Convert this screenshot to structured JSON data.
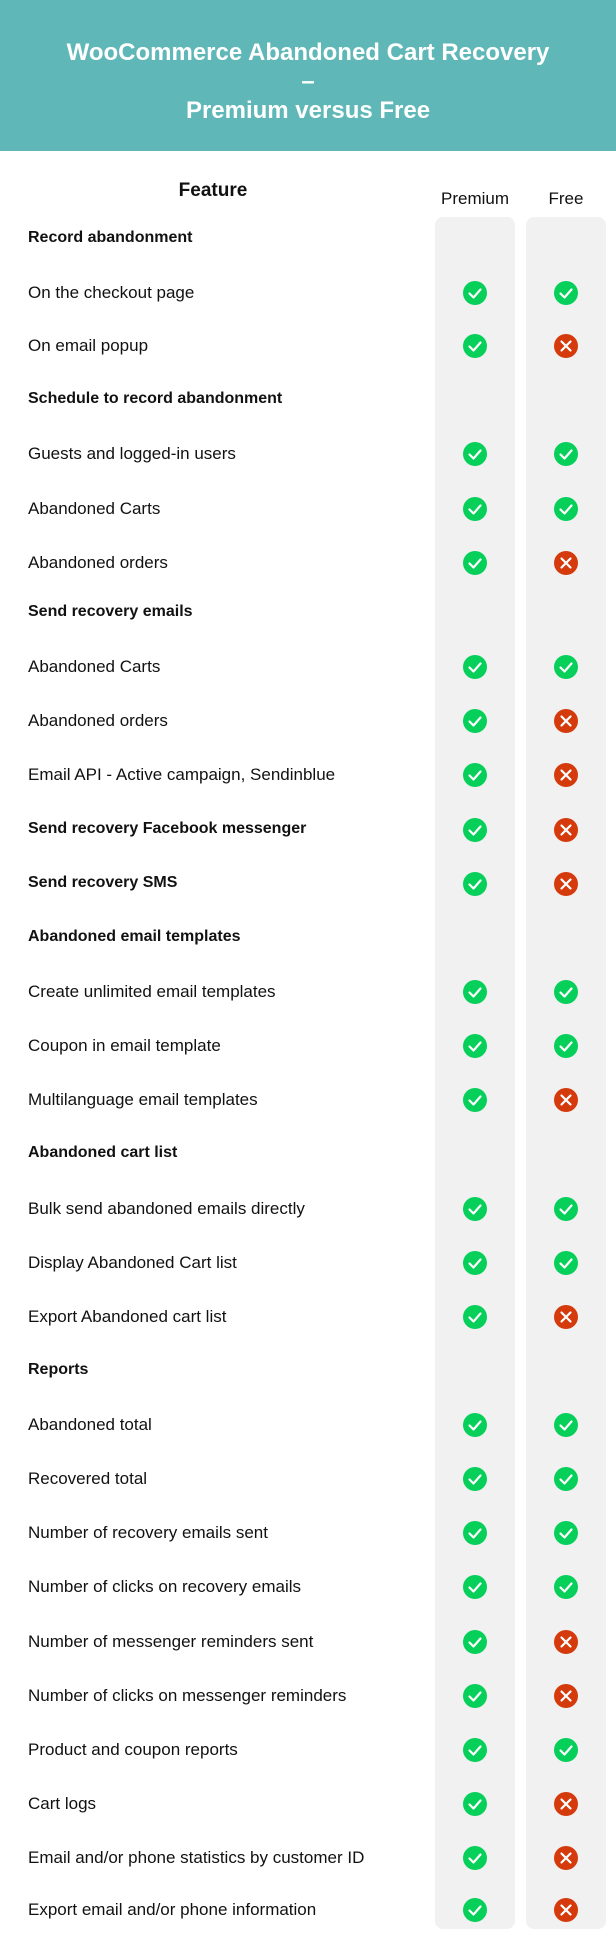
{
  "header": {
    "title_line1": "WooCommerce Abandoned Cart Recovery",
    "title_line2": "–",
    "title_line3": "Premium versus Free",
    "background_color": "#5fb7b7"
  },
  "columns": {
    "feature": "Feature",
    "premium": "Premium",
    "free": "Free"
  },
  "colors": {
    "yes": "#06cf5a",
    "no": "#d43a0b",
    "column_bg": "#f1f1f1"
  },
  "rows": [
    {
      "label": "Record abandonment",
      "section": true,
      "premium": null,
      "free": null
    },
    {
      "label": "On the checkout page",
      "section": false,
      "premium": "yes",
      "free": "yes"
    },
    {
      "label": "On email popup",
      "section": false,
      "premium": "yes",
      "free": "no"
    },
    {
      "label": "Schedule to record abandonment",
      "section": true,
      "premium": null,
      "free": null
    },
    {
      "label": "Guests and logged-in users",
      "section": false,
      "premium": "yes",
      "free": "yes"
    },
    {
      "label": "Abandoned Carts",
      "section": false,
      "premium": "yes",
      "free": "yes"
    },
    {
      "label": "Abandoned orders",
      "section": false,
      "premium": "yes",
      "free": "no"
    },
    {
      "label": "Send recovery emails",
      "section": true,
      "premium": null,
      "free": null
    },
    {
      "label": "Abandoned Carts",
      "section": false,
      "premium": "yes",
      "free": "yes"
    },
    {
      "label": "Abandoned orders",
      "section": false,
      "premium": "yes",
      "free": "no"
    },
    {
      "label": "Email API - Active campaign, Sendinblue",
      "section": false,
      "premium": "yes",
      "free": "no"
    },
    {
      "label": "Send recovery Facebook messenger",
      "section": true,
      "premium": "yes",
      "free": "no"
    },
    {
      "label": "Send recovery SMS",
      "section": true,
      "premium": "yes",
      "free": "no"
    },
    {
      "label": "Abandoned email templates",
      "section": true,
      "premium": null,
      "free": null
    },
    {
      "label": "Create unlimited email templates",
      "section": false,
      "premium": "yes",
      "free": "yes"
    },
    {
      "label": "Coupon in email template",
      "section": false,
      "premium": "yes",
      "free": "yes"
    },
    {
      "label": "Multilanguage email templates",
      "section": false,
      "premium": "yes",
      "free": "no"
    },
    {
      "label": "Abandoned cart list",
      "section": true,
      "premium": null,
      "free": null
    },
    {
      "label": "Bulk send abandoned emails directly",
      "section": false,
      "premium": "yes",
      "free": "yes"
    },
    {
      "label": "Display Abandoned Cart list",
      "section": false,
      "premium": "yes",
      "free": "yes"
    },
    {
      "label": "Export Abandoned cart list",
      "section": false,
      "premium": "yes",
      "free": "no"
    },
    {
      "label": "Reports",
      "section": true,
      "premium": null,
      "free": null
    },
    {
      "label": "Abandoned total",
      "section": false,
      "premium": "yes",
      "free": "yes"
    },
    {
      "label": "Recovered total",
      "section": false,
      "premium": "yes",
      "free": "yes"
    },
    {
      "label": "Number of recovery emails sent",
      "section": false,
      "premium": "yes",
      "free": "yes"
    },
    {
      "label": "Number of clicks on recovery emails",
      "section": false,
      "premium": "yes",
      "free": "yes"
    },
    {
      "label": "Number of messenger reminders sent",
      "section": false,
      "premium": "yes",
      "free": "no"
    },
    {
      "label": "Number of clicks on messenger reminders",
      "section": false,
      "premium": "yes",
      "free": "no"
    },
    {
      "label": "Product and coupon reports",
      "section": false,
      "premium": "yes",
      "free": "yes"
    },
    {
      "label": "Cart logs",
      "section": false,
      "premium": "yes",
      "free": "no"
    },
    {
      "label": "Email and/or phone statistics by customer ID",
      "section": false,
      "premium": "yes",
      "free": "no"
    },
    {
      "label": "Export email and/or phone information",
      "section": false,
      "premium": "yes",
      "free": "no"
    }
  ]
}
